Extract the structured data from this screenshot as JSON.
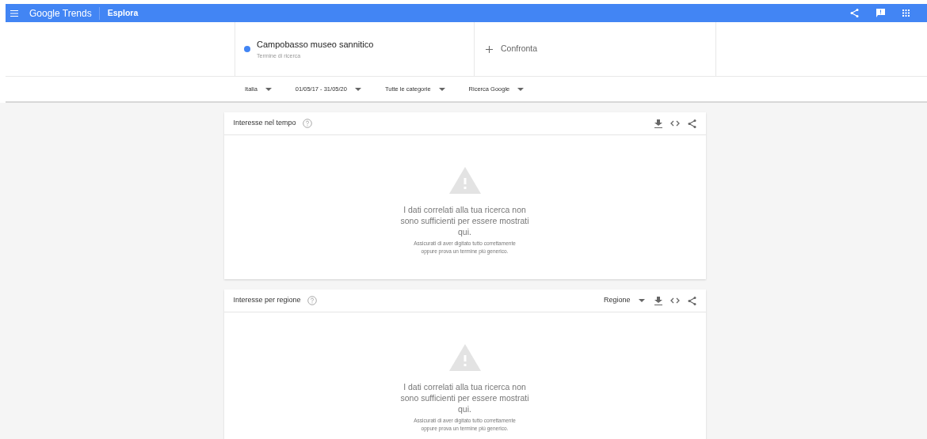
{
  "header": {
    "logo": "Google Trends",
    "section": "Esplora"
  },
  "search": {
    "term": "Campobasso museo sannitico",
    "subtitle": "Termine di ricerca",
    "compare": "Confronta"
  },
  "filters": [
    {
      "label": "Italia"
    },
    {
      "label": "01/05/17 - 31/05/20"
    },
    {
      "label": "Tutte le categorie"
    },
    {
      "label": "Ricerca Google"
    }
  ],
  "cards": [
    {
      "title": "Interesse nel tempo",
      "message": "I dati correlati alla tua ricerca non sono sufficienti per essere mostrati qui.",
      "hint": "Assicurati di aver digitato tutto correttamente oppure prova un termine più generico."
    },
    {
      "title": "Interesse per regione",
      "dropdown": "Regione",
      "message": "I dati correlati alla tua ricerca non sono sufficienti per essere mostrati qui.",
      "hint": "Assicurati di aver digitato tutto correttamente oppure prova un termine più generico."
    }
  ]
}
